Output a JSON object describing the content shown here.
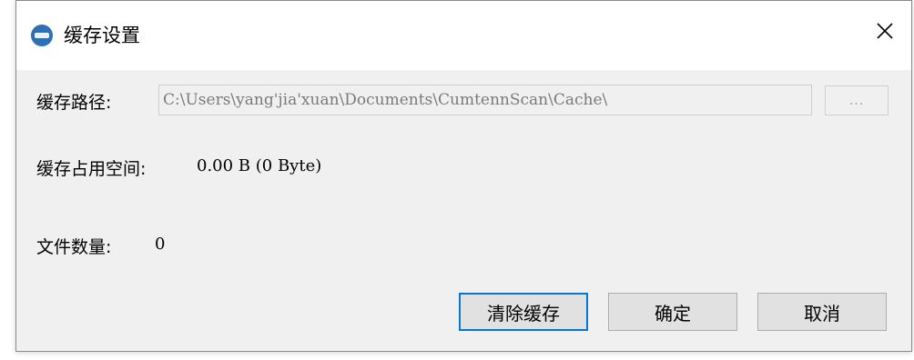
{
  "window": {
    "title": "缓存设置",
    "icon": "app-logo-icon",
    "close_icon": "close-icon"
  },
  "cache_path": {
    "label": "缓存路径:",
    "value": "C:\\Users\\yang'jia'xuan\\Documents\\CumtennScan\\Cache\\",
    "browse_label": "..."
  },
  "cache_size": {
    "label": "缓存占用空间:",
    "value": "0.00 B (0 Byte)"
  },
  "file_count": {
    "label": "文件数量:",
    "value": "0"
  },
  "buttons": {
    "clear_label": "清除缓存",
    "ok_label": "确定",
    "cancel_label": "取消"
  },
  "colors": {
    "focus_border": "#0078d7",
    "dialog_bg": "#f0f0f0"
  }
}
